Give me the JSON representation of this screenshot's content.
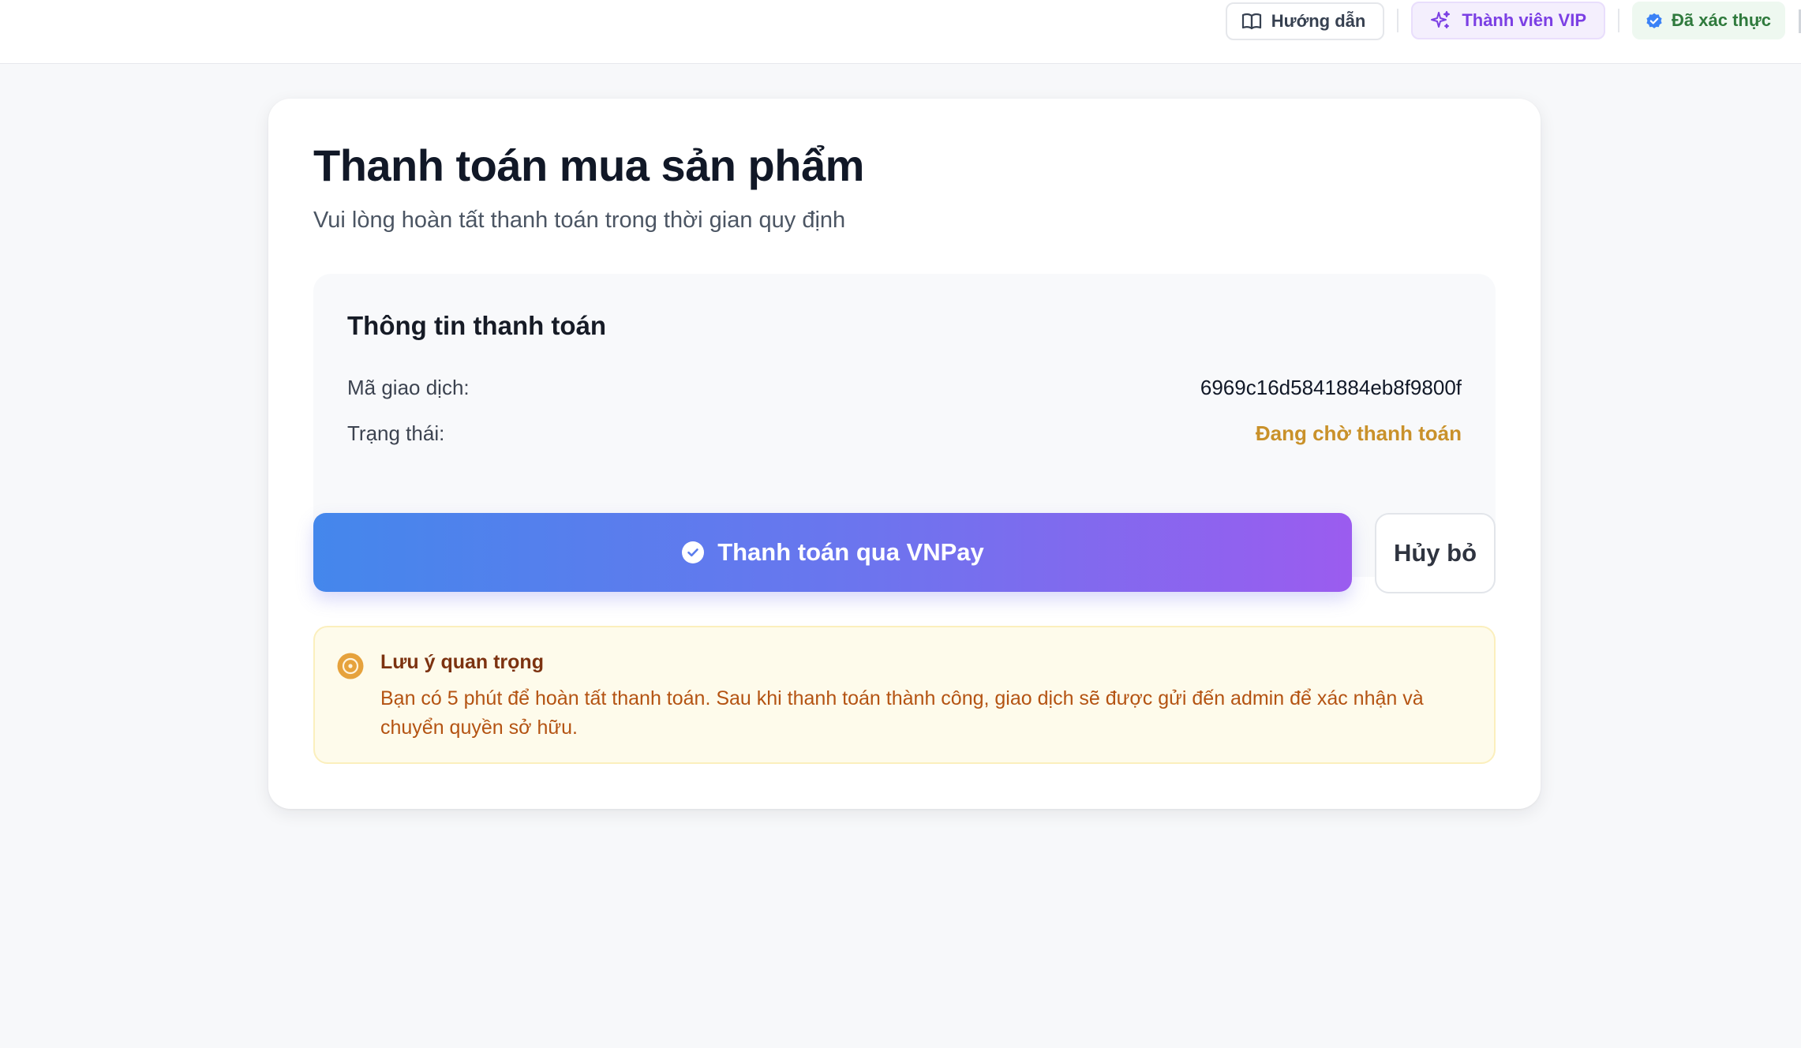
{
  "header": {
    "guide_label": "Hướng dẫn",
    "vip_label": "Thành viên VIP",
    "verified_label": "Đã xác thực"
  },
  "page": {
    "title": "Thanh toán mua sản phẩm",
    "subtitle": "Vui lòng hoàn tất thanh toán trong thời gian quy định"
  },
  "payment_info": {
    "title": "Thông tin thanh toán",
    "transaction_label": "Mã giao dịch:",
    "transaction_id": "6969c16d5841884eb8f9800f",
    "status_label": "Trạng thái:",
    "status_value": "Đang chờ thanh toán"
  },
  "actions": {
    "pay_label": "Thanh toán qua VNPay",
    "cancel_label": "Hủy bỏ"
  },
  "notice": {
    "title": "Lưu ý quan trọng",
    "body": "Bạn có 5 phút để hoàn tất thanh toán. Sau khi thanh toán thành công, giao dịch sẽ được gửi đến admin để xác nhận và chuyển quyền sở hữu."
  },
  "colors": {
    "pay_gradient_start": "#4487ec",
    "pay_gradient_end": "#9b5cef",
    "status_pending": "#c9912a",
    "vip_accent": "#7b3fe4",
    "verified_accent": "#2f7a3d",
    "notice_background": "#fefbeb",
    "notice_text": "#b45312"
  },
  "icons": {
    "guide": "book-open-icon",
    "vip": "sparkles-icon",
    "verified": "badge-check-icon",
    "pay": "check-circle-icon",
    "notice": "clock-icon"
  }
}
